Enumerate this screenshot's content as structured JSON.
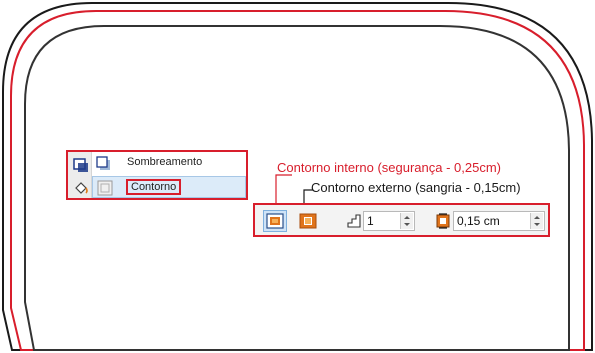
{
  "menu": {
    "items": [
      {
        "label": "Sombreamento",
        "icon": "drop-shadow-icon"
      },
      {
        "label": "Contorno",
        "icon": "contour-icon",
        "selected": true
      }
    ],
    "gutter_icons": [
      "shadow-tool-icon",
      "fill-bucket-icon"
    ]
  },
  "annotations": {
    "internal": "Contorno interno (segurança - 0,25cm)",
    "external": "Contorno externo (sangria - 0,15cm)"
  },
  "property_bar": {
    "inside_contour_icon": "inside-contour-icon",
    "outside_contour_icon": "outside-contour-icon",
    "steps_value": "1",
    "offset_value": "0,15 cm"
  },
  "colors": {
    "highlight": "#d81e2c",
    "shape_outline": "#1a1a1a",
    "inside_contour": "#d81e2c",
    "outside_contour": "#333333"
  }
}
